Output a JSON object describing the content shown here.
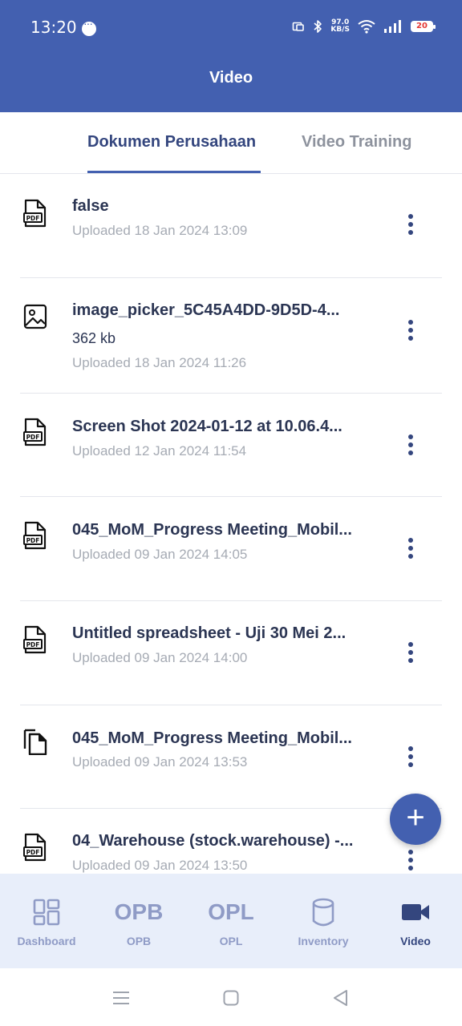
{
  "status": {
    "time": "13:20",
    "net_speed_value": "97.0",
    "net_speed_unit": "KB/S",
    "battery": "20"
  },
  "appbar": {
    "title": "Video"
  },
  "tabs": [
    {
      "label": "Dokumen Perusahaan",
      "selected": true
    },
    {
      "label": "Video Training",
      "selected": false
    }
  ],
  "files": [
    {
      "icon": "pdf-file-icon",
      "title": "false",
      "size": "",
      "date": "Uploaded 18 Jan 2024 13:09"
    },
    {
      "icon": "image-file-icon",
      "title": "image_picker_5C45A4DD-9D5D-4...",
      "size": "362 kb",
      "date": "Uploaded 18 Jan 2024 11:26"
    },
    {
      "icon": "pdf-file-icon",
      "title": "Screen Shot 2024-01-12 at 10.06.4...",
      "size": "",
      "date": "Uploaded 12 Jan 2024 11:54"
    },
    {
      "icon": "pdf-file-icon",
      "title": "045_MoM_Progress Meeting_Mobil...",
      "size": "",
      "date": "Uploaded 09 Jan 2024 14:05"
    },
    {
      "icon": "pdf-file-icon",
      "title": "Untitled spreadsheet - Uji 30 Mei 2...",
      "size": "",
      "date": "Uploaded 09 Jan 2024 14:00"
    },
    {
      "icon": "copy-file-icon",
      "title": "045_MoM_Progress Meeting_Mobil...",
      "size": "",
      "date": "Uploaded 09 Jan 2024 13:53"
    },
    {
      "icon": "pdf-file-icon",
      "title": "04_Warehouse (stock.warehouse) -...",
      "size": "",
      "date": "Uploaded 09 Jan 2024 13:50"
    }
  ],
  "fab": {
    "label": "+"
  },
  "bottom_nav": [
    {
      "label": "Dashboard",
      "icon": "dashboard-grid-icon",
      "icon_text": "",
      "active": false
    },
    {
      "label": "OPB",
      "icon": "opb-text-icon",
      "icon_text": "OPB",
      "active": false
    },
    {
      "label": "OPL",
      "icon": "opl-text-icon",
      "icon_text": "OPL",
      "active": false
    },
    {
      "label": "Inventory",
      "icon": "database-icon",
      "icon_text": "",
      "active": false
    },
    {
      "label": "Video",
      "icon": "video-camera-icon",
      "icon_text": "",
      "active": true
    }
  ],
  "colors": {
    "primary": "#4360b0",
    "text_dark": "#2b3553",
    "text_muted": "#a6abb4",
    "nav_bg": "#e8eefa",
    "nav_inactive": "#8f9bc6",
    "battery_low": "#e53935"
  }
}
